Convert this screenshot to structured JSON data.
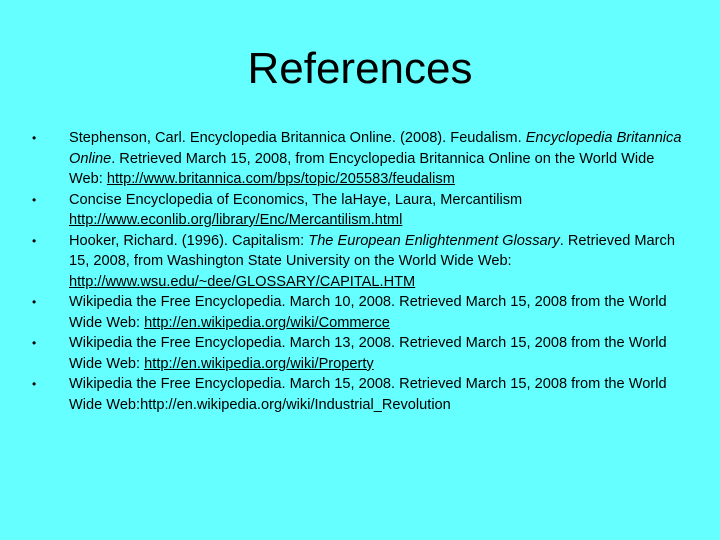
{
  "slide": {
    "title": "References",
    "bullet": "•",
    "references": [
      {
        "parts": [
          {
            "t": "Stephenson, Carl.  Encyclopedia Britannica Online. (2008). Feudalism. "
          },
          {
            "t": "Encyclopedia Britannica Online",
            "i": true
          },
          {
            "t": ". Retrieved March 15, 2008, from Encyclopedia Britannica Online on the World Wide Web: "
          },
          {
            "t": "http://www.britannica.com/bps/topic/205583/feudalism",
            "u": true
          }
        ]
      },
      {
        "parts": [
          {
            "t": "Concise Encyclopedia of Economics, The laHaye, Laura, Mercantilism "
          },
          {
            "t": "http://www.econlib.org/library/Enc/Mercantilism.html",
            "u": true
          }
        ]
      },
      {
        "parts": [
          {
            "t": "Hooker, Richard. (1996). Capitalism: "
          },
          {
            "t": "The European Enlightenment Glossary",
            "i": true
          },
          {
            "t": ". Retrieved March 15, 2008, from Washington State University on the World Wide Web: "
          },
          {
            "t": "http://www.wsu.edu/~dee/GLOSSARY/CAPITAL.HTM",
            "u": true
          }
        ]
      },
      {
        "parts": [
          {
            "t": "Wikipedia the Free Encyclopedia. March 10, 2008. Retrieved March 15, 2008 from the World Wide Web: "
          },
          {
            "t": "http://en.wikipedia.org/wiki/Commerce",
            "u": true
          }
        ]
      },
      {
        "parts": [
          {
            "t": "Wikipedia the Free Encyclopedia. March 13, 2008. Retrieved March 15, 2008 from the World Wide Web: "
          },
          {
            "t": "http://en.wikipedia.org/wiki/Property",
            "u": true
          }
        ]
      },
      {
        "parts": [
          {
            "t": "Wikipedia the Free Encyclopedia. March 15, 2008. Retrieved March 15, 2008 from the World Wide Web:http://en.wikipedia.org/wiki/Industrial_Revolution"
          }
        ]
      }
    ]
  }
}
